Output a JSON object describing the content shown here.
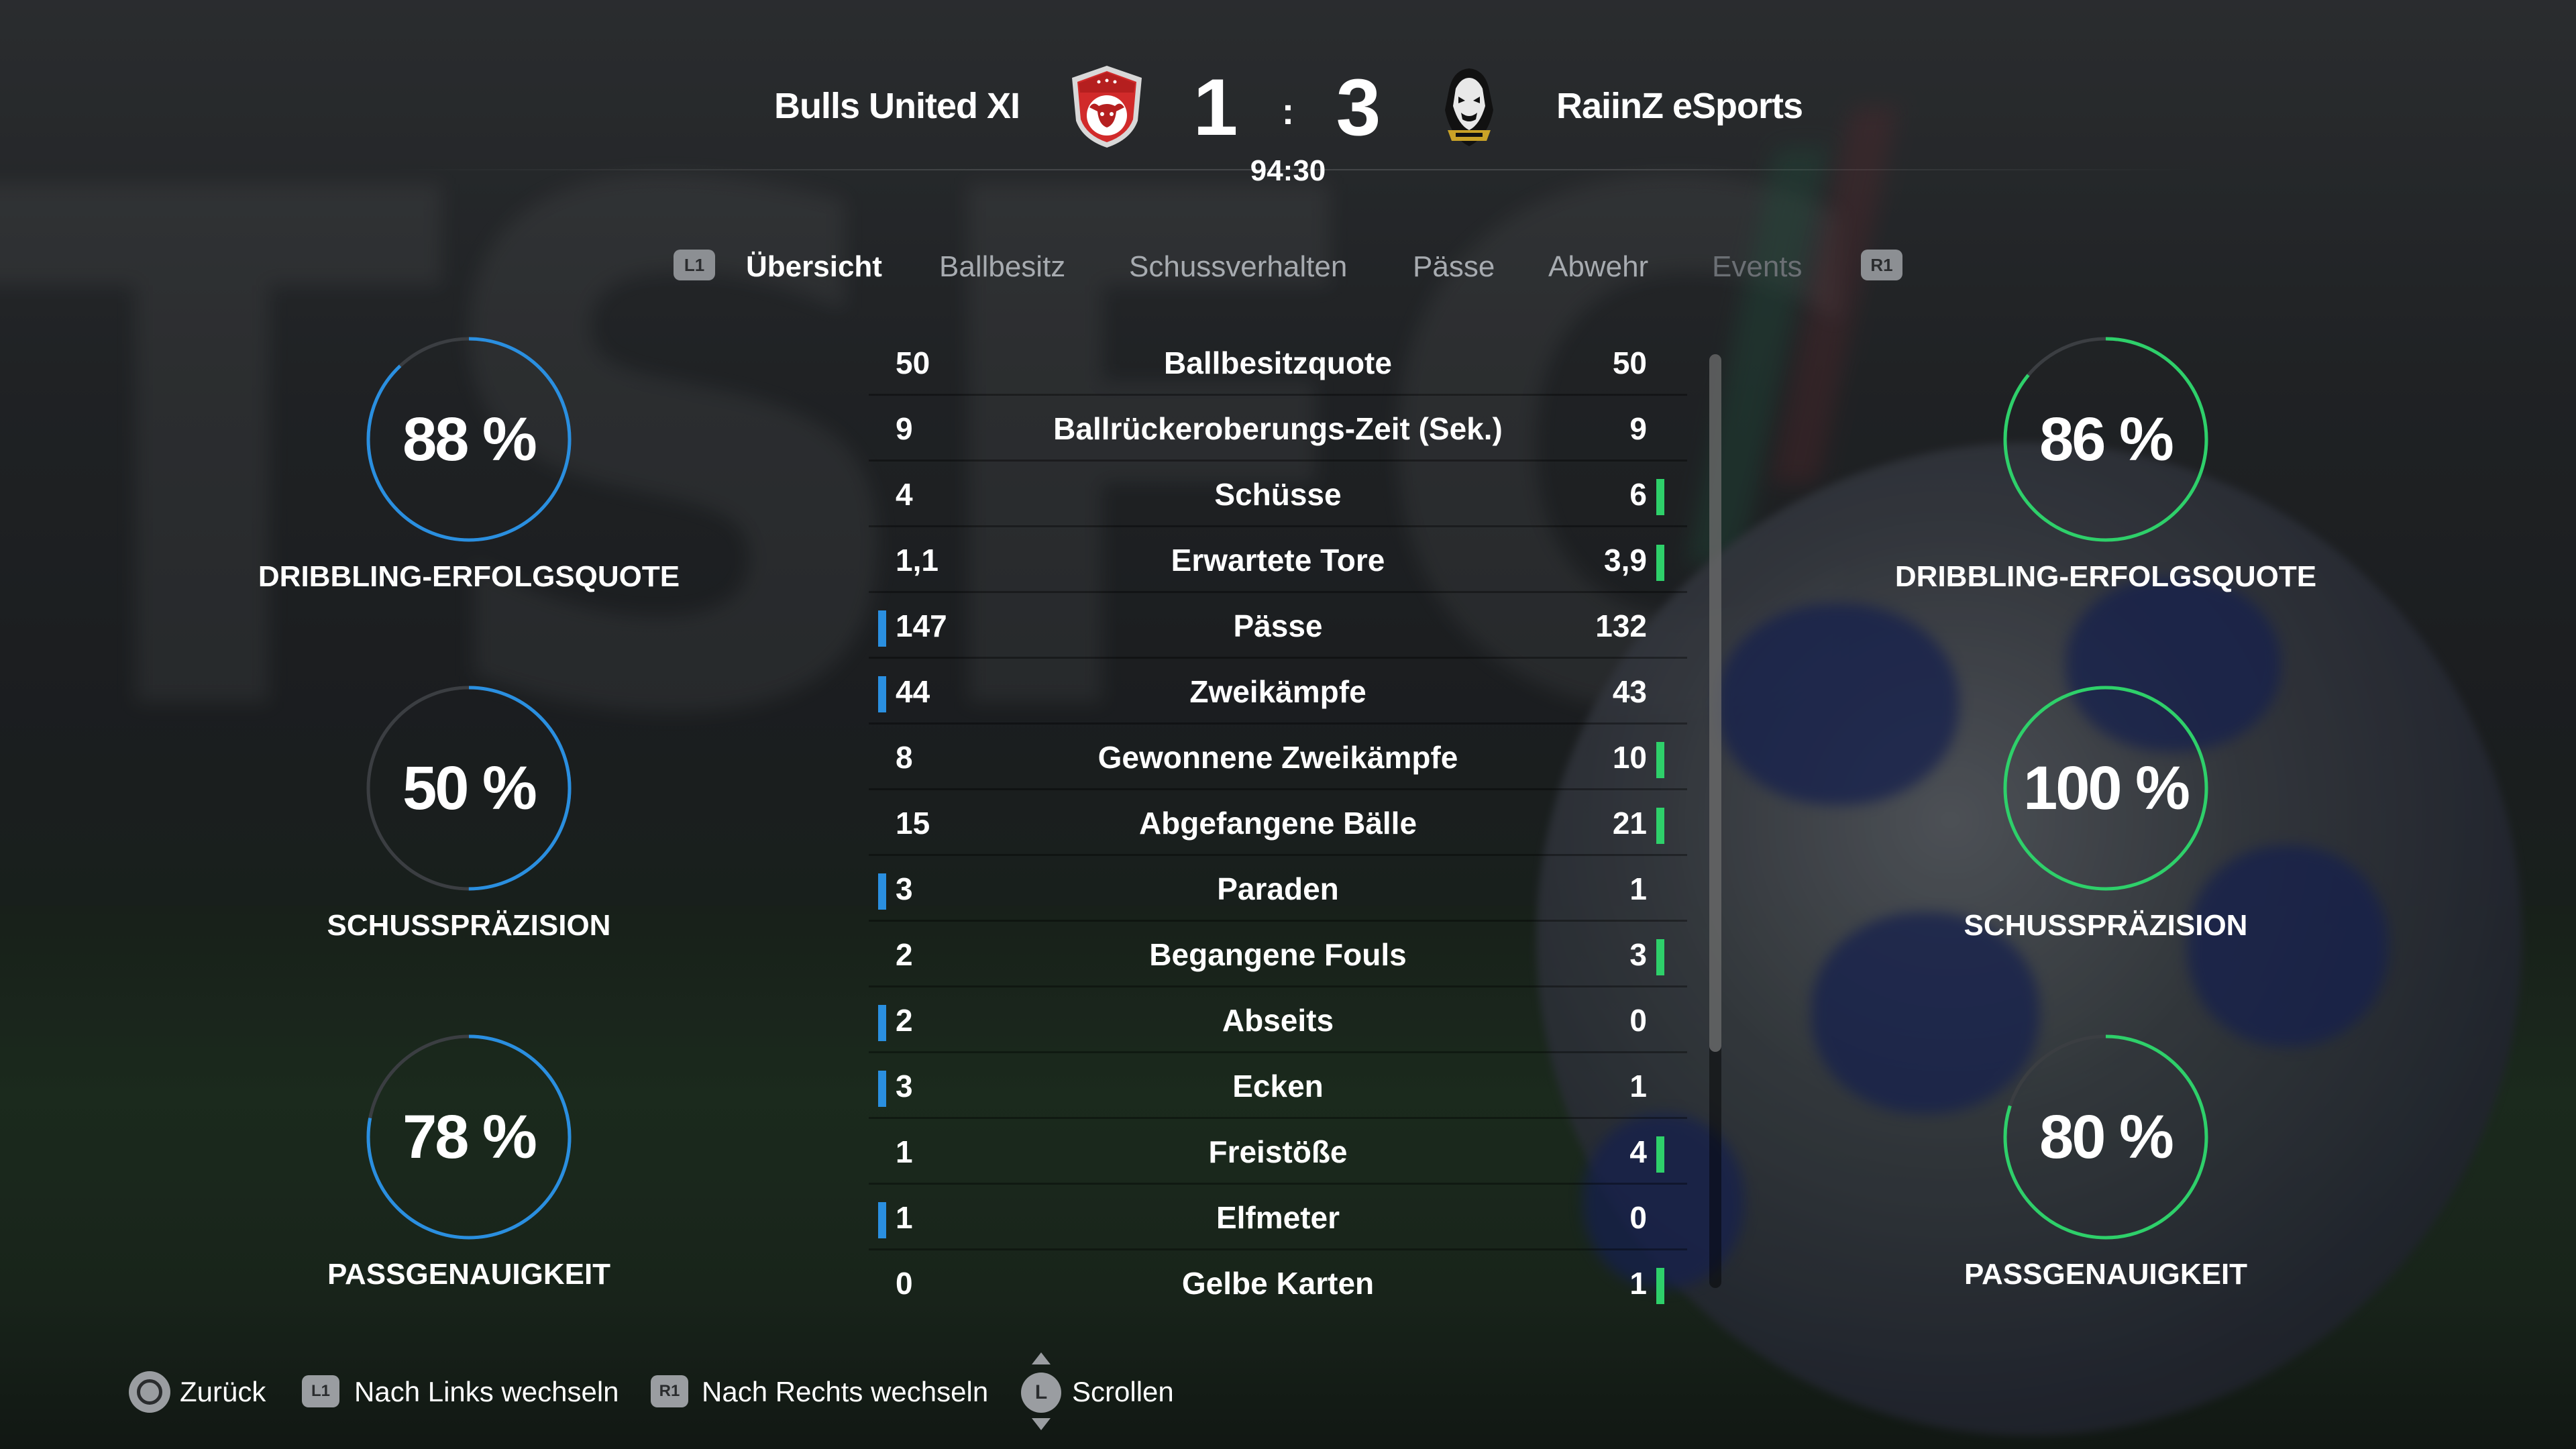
{
  "match": {
    "home_team": "Bulls United XI",
    "away_team": "RaiinZ eSports",
    "home_score": "1",
    "away_score": "3",
    "separator": ":",
    "clock": "94:30",
    "home_crest_icon": "bull-shield-crest-icon",
    "away_crest_icon": "raiinz-mascot-crest-icon"
  },
  "tabs": {
    "prev_button": "L1",
    "next_button": "R1",
    "items": [
      {
        "label": "Übersicht",
        "active": true
      },
      {
        "label": "Ballbesitz",
        "active": false
      },
      {
        "label": "Schussverhalten",
        "active": false
      },
      {
        "label": "Pässe",
        "active": false
      },
      {
        "label": "Abwehr",
        "active": false
      },
      {
        "label": "Events",
        "active": false
      }
    ]
  },
  "left_gauges": [
    {
      "value": "88 %",
      "label": "DRIBBLING-ERFOLGSQUOTE",
      "fraction": 0.88
    },
    {
      "value": "50 %",
      "label": "SCHUSSPRÄZISION",
      "fraction": 0.5
    },
    {
      "value": "78 %",
      "label": "PASSGENAUIGKEIT",
      "fraction": 0.78
    }
  ],
  "right_gauges": [
    {
      "value": "86 %",
      "label": "DRIBBLING-ERFOLGSQUOTE",
      "fraction": 0.86
    },
    {
      "value": "100 %",
      "label": "SCHUSSPRÄZISION",
      "fraction": 1.0
    },
    {
      "value": "80 %",
      "label": "PASSGENAUIGKEIT",
      "fraction": 0.8
    }
  ],
  "colors": {
    "home": "#2a8fe0",
    "away": "#2ed06a",
    "gauge_track": "#3b3e42"
  },
  "stats": [
    {
      "name": "Ballbesitzquote",
      "home": "50",
      "away": "50",
      "leader": "none"
    },
    {
      "name": "Ballrückeroberungs-Zeit (Sek.)",
      "home": "9",
      "away": "9",
      "leader": "none"
    },
    {
      "name": "Schüsse",
      "home": "4",
      "away": "6",
      "leader": "away"
    },
    {
      "name": "Erwartete Tore",
      "home": "1,1",
      "away": "3,9",
      "leader": "away"
    },
    {
      "name": "Pässe",
      "home": "147",
      "away": "132",
      "leader": "home"
    },
    {
      "name": "Zweikämpfe",
      "home": "44",
      "away": "43",
      "leader": "home"
    },
    {
      "name": "Gewonnene Zweikämpfe",
      "home": "8",
      "away": "10",
      "leader": "away"
    },
    {
      "name": "Abgefangene Bälle",
      "home": "15",
      "away": "21",
      "leader": "away"
    },
    {
      "name": "Paraden",
      "home": "3",
      "away": "1",
      "leader": "home"
    },
    {
      "name": "Begangene Fouls",
      "home": "2",
      "away": "3",
      "leader": "away"
    },
    {
      "name": "Abseits",
      "home": "2",
      "away": "0",
      "leader": "home"
    },
    {
      "name": "Ecken",
      "home": "3",
      "away": "1",
      "leader": "home"
    },
    {
      "name": "Freistöße",
      "home": "1",
      "away": "4",
      "leader": "away"
    },
    {
      "name": "Elfmeter",
      "home": "1",
      "away": "0",
      "leader": "home"
    },
    {
      "name": "Gelbe Karten",
      "home": "0",
      "away": "1",
      "leader": "away"
    }
  ],
  "footer": {
    "back_label": "Zurück",
    "left_chip": "L1",
    "left_label": "Nach Links wechseln",
    "right_chip": "R1",
    "right_label": "Nach Rechts wechseln",
    "stick_label": "L",
    "scroll_label": "Scrollen"
  }
}
